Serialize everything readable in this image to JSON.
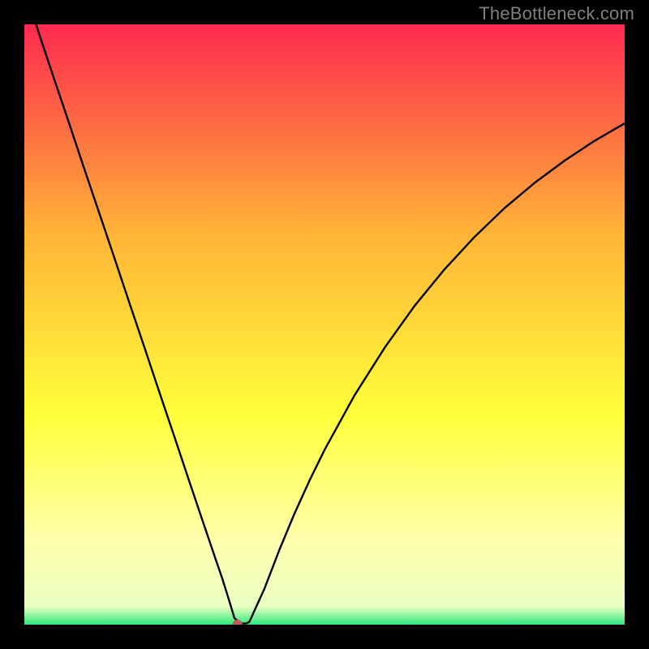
{
  "watermark": "TheBottleneck.com",
  "chart_data": {
    "type": "line",
    "title": "",
    "xlabel": "",
    "ylabel": "",
    "xlim": [
      0,
      100
    ],
    "ylim": [
      0,
      100
    ],
    "background_gradient": {
      "top": "#fd2a4f",
      "mid_warm": "#ffb437",
      "mid_yellow": "#ffff3a",
      "pale_band": "#ffffad",
      "bottom": "#2de87c"
    },
    "marker": {
      "x": 35.5,
      "y": 0,
      "color": "#c05a5a",
      "radius_pct": 0.85
    },
    "series": [
      {
        "name": "curve",
        "x": [
          0,
          2.5,
          5,
          7.5,
          10,
          12.5,
          15,
          17.5,
          20,
          22.5,
          25,
          27.5,
          30,
          32,
          33,
          34,
          35,
          36,
          37,
          37.5,
          40,
          42.5,
          45,
          47.5,
          50,
          55,
          60,
          65,
          70,
          75,
          80,
          85,
          90,
          95,
          100
        ],
        "y": [
          106,
          98.3,
          90.8,
          83.4,
          75.9,
          68.5,
          61.1,
          53.6,
          46.2,
          38.7,
          31.3,
          23.8,
          16.4,
          10.5,
          7.6,
          4.4,
          1.1,
          0.2,
          0.2,
          0.5,
          6.0,
          12.5,
          18.5,
          24.0,
          29.1,
          38.2,
          46.1,
          53.1,
          59.2,
          64.6,
          69.4,
          73.6,
          77.3,
          80.6,
          83.5
        ]
      }
    ]
  }
}
